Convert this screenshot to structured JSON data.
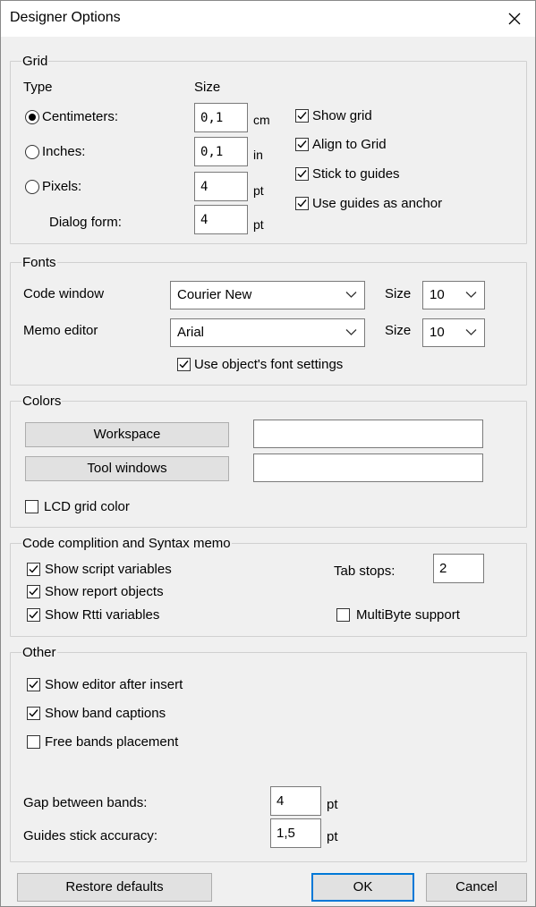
{
  "window": {
    "title": "Designer Options"
  },
  "grid": {
    "group_label": "Grid",
    "type_header": "Type",
    "size_header": "Size",
    "units": [
      {
        "label": "Centimeters:",
        "value": "0,1",
        "unit": "cm",
        "selected": true
      },
      {
        "label": "Inches:",
        "value": "0,1",
        "unit": "in",
        "selected": false
      },
      {
        "label": "Pixels:",
        "value": "4",
        "unit": "pt",
        "selected": false
      }
    ],
    "dialog_form": {
      "label": "Dialog form:",
      "value": "4",
      "unit": "pt"
    },
    "options": [
      {
        "label": "Show grid",
        "checked": true
      },
      {
        "label": "Align to Grid",
        "checked": true
      },
      {
        "label": "Stick to guides",
        "checked": true
      },
      {
        "label": "Use guides as anchor",
        "checked": true
      }
    ]
  },
  "fonts": {
    "group_label": "Fonts",
    "code_window": {
      "label": "Code window",
      "font": "Courier New",
      "size_label": "Size",
      "size": "10"
    },
    "memo_editor": {
      "label": "Memo editor",
      "font": "Arial",
      "size_label": "Size",
      "size": "10"
    },
    "use_object_font": {
      "label": "Use object's font settings",
      "checked": true
    }
  },
  "colors": {
    "group_label": "Colors",
    "workspace_button": "Workspace",
    "tool_windows_button": "Tool windows",
    "lcd_grid": {
      "label": "LCD grid color",
      "checked": false
    }
  },
  "code": {
    "group_label": "Code complition and  Syntax memo",
    "options": [
      {
        "label": "Show script variables",
        "checked": true
      },
      {
        "label": "Show report objects",
        "checked": true
      },
      {
        "label": "Show Rtti variables",
        "checked": true
      }
    ],
    "tab_stops_label": "Tab stops:",
    "tab_stops_value": "2",
    "multibyte": {
      "label": "MultiByte support",
      "checked": false
    }
  },
  "other": {
    "group_label": "Other",
    "options": [
      {
        "label": "Show editor after insert",
        "checked": true
      },
      {
        "label": "Show band captions",
        "checked": true
      },
      {
        "label": "Free bands placement",
        "checked": false
      }
    ],
    "gap": {
      "label": "Gap between bands:",
      "value": "4",
      "unit": "pt"
    },
    "guides": {
      "label": "Guides stick accuracy:",
      "value": "1,5",
      "unit": "pt"
    }
  },
  "buttons": {
    "restore": "Restore defaults",
    "ok": "OK",
    "cancel": "Cancel"
  }
}
